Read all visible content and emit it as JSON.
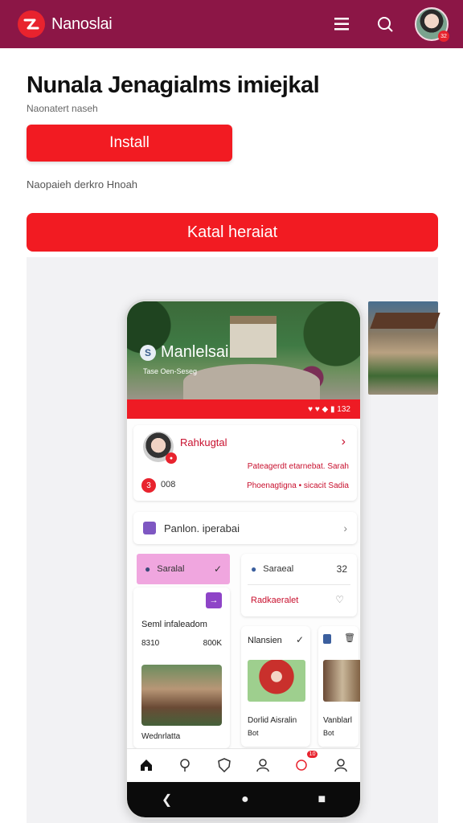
{
  "header": {
    "brand": "Nanoslai",
    "colors": {
      "bar": "#8c1646",
      "accent": "#f21b22"
    },
    "icons": [
      "menu-icon",
      "search-icon",
      "avatar"
    ],
    "avatar_badge": "32"
  },
  "main": {
    "title": "Nunala Jenagialms imiejkal",
    "subtitle": "Naonatert naseh",
    "install_label": "Install",
    "note": "Naopaieh derkro Hnoah",
    "cta_label": "Katal heraiat"
  },
  "phone": {
    "hero": {
      "title": "Manlelsai",
      "subtitle": "Tase Oen-Seseg"
    },
    "status_text": "♥ ♥ ◆ ▮ 132",
    "profile": {
      "name": "Rahkugtal",
      "line1": "Pateagerdt etarnebat. Sarah",
      "line2": "Phoenagtigna • sicacit Sadia",
      "badge": "3",
      "count": "008"
    },
    "row": {
      "label": "Panlon. iperabai"
    },
    "pill": {
      "label": "Saralal"
    },
    "card1": {
      "badge": "→",
      "title": "Seml infaleadom",
      "a": "8310",
      "b": "800K",
      "footer": "Wednrlatta"
    },
    "card2": {
      "top": "Saraeal",
      "num": "32",
      "bottom": "Radkaeralet"
    },
    "card3": {
      "title": "Nlansien",
      "line1": "Dorlid Aisralin",
      "line2": "Bot"
    },
    "card4": {
      "line1": "Vanblarl",
      "line2": "Bot"
    },
    "tab_notif": "10"
  }
}
